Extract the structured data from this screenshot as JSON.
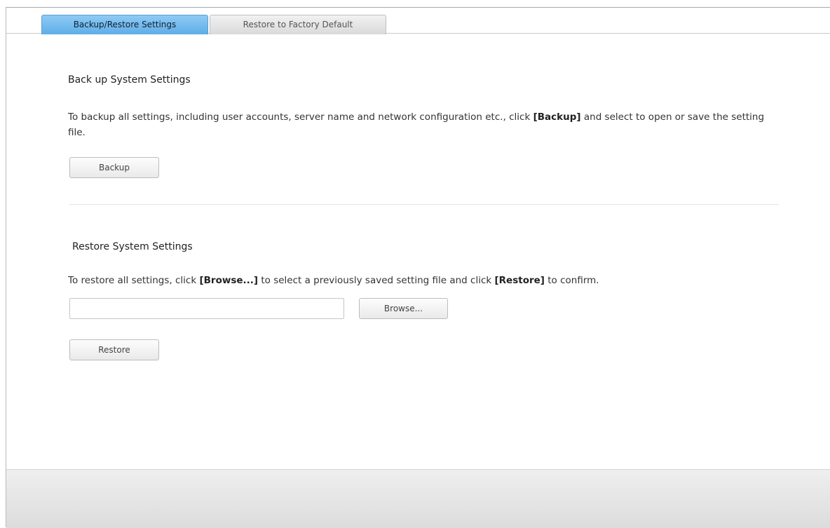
{
  "tabs": [
    {
      "label": "Backup/Restore Settings",
      "active": true
    },
    {
      "label": "Restore to Factory Default",
      "active": false
    }
  ],
  "backup": {
    "heading": "Back up System Settings",
    "desc_before": "To backup all settings, including user accounts, server name and network configuration etc., click ",
    "desc_bold": "[Backup]",
    "desc_after": " and select to open or save the setting file.",
    "button_label": "Backup"
  },
  "restore": {
    "heading": "Restore System Settings",
    "desc_before": "To restore all settings, click ",
    "desc_bold1": "[Browse...]",
    "desc_middle": " to select a previously saved setting file and click ",
    "desc_bold2": "[Restore]",
    "desc_after": " to confirm.",
    "file_value": "",
    "browse_label": "Browse...",
    "restore_label": "Restore"
  },
  "colors": {
    "active_tab": "#6db8ec",
    "footer": "#e4e4e4"
  }
}
